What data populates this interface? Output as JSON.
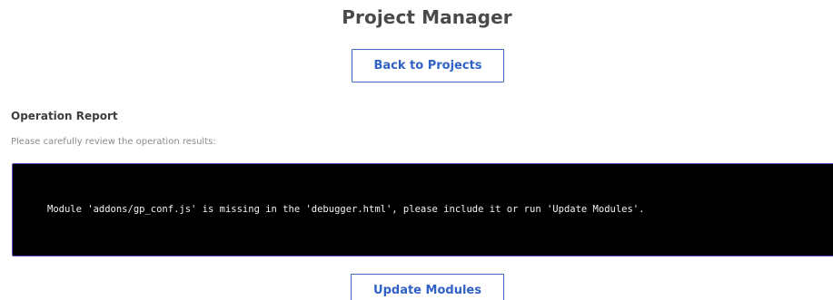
{
  "header": {
    "title": "Project Manager"
  },
  "actions": {
    "back_label": "Back to Projects",
    "update_label": "Update Modules"
  },
  "report": {
    "title": "Operation Report",
    "subtitle": "Please carefully review the operation results:",
    "message": "Module 'addons/gp_conf.js' is missing in the 'debugger.html', please include it or run 'Update Modules'."
  }
}
